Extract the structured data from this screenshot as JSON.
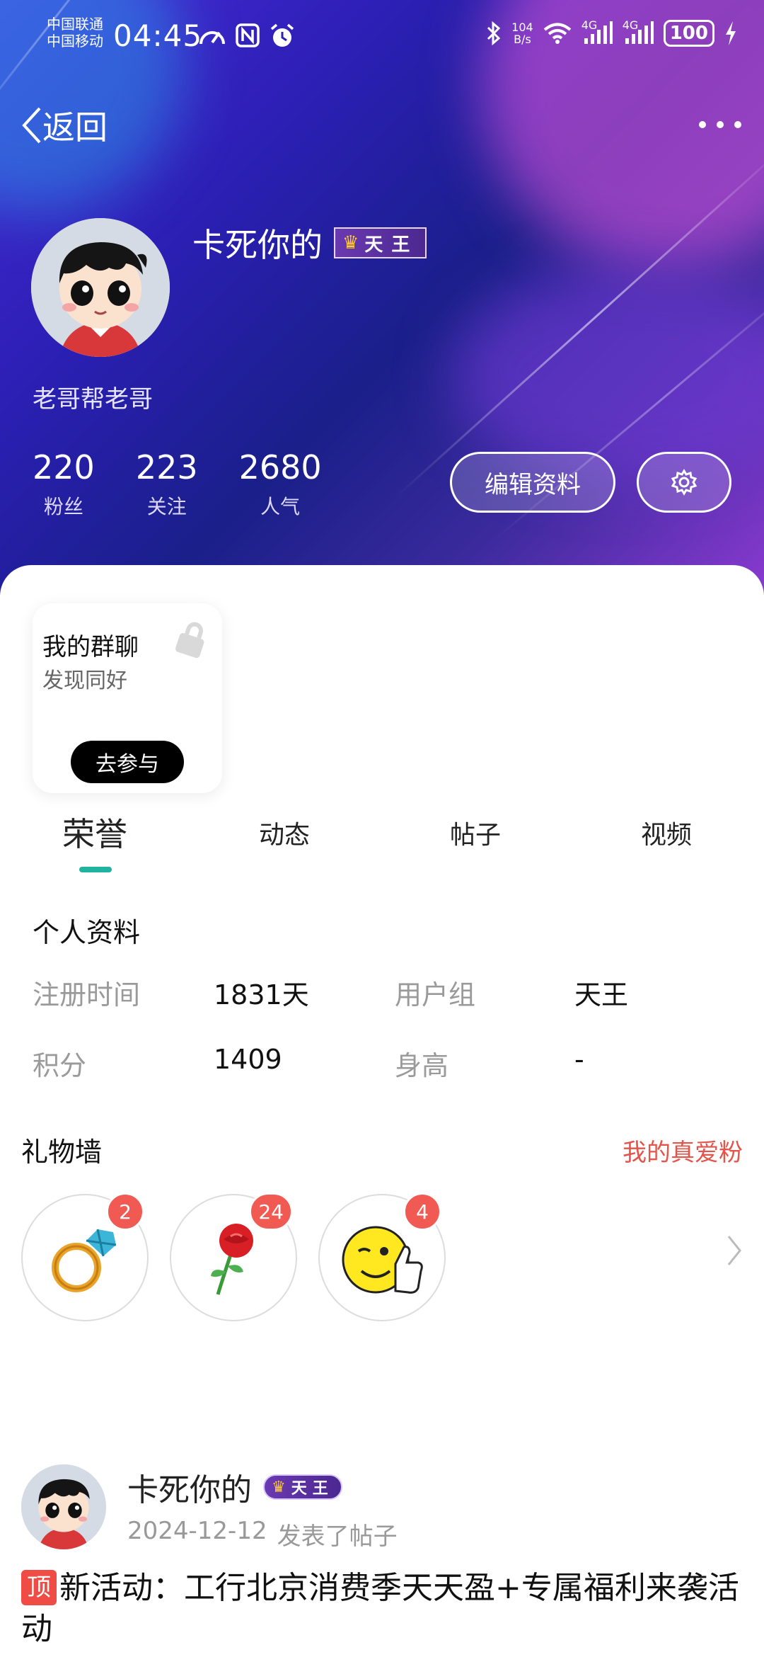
{
  "status_bar": {
    "carrier1": "中国联通",
    "carrier2": "中国移动",
    "time": "04:45",
    "net_speed_value": "104",
    "net_speed_unit": "B/s",
    "signal1_type": "4G",
    "signal2_type": "4G",
    "battery": "100",
    "icons_left": [
      "speedometer-icon",
      "nfc-icon",
      "alarm-icon"
    ],
    "icons_right": [
      "bluetooth-icon",
      "wifi-icon",
      "signal-icon",
      "charging-icon"
    ]
  },
  "nav": {
    "back_label": "返回",
    "more_icon": "more-dots-icon"
  },
  "profile": {
    "username": "卡死你的",
    "rank_badge": "天王",
    "signature": "老哥帮老哥",
    "stats": [
      {
        "value": "220",
        "label": "粉丝"
      },
      {
        "value": "223",
        "label": "关注"
      },
      {
        "value": "2680",
        "label": "人气"
      }
    ],
    "edit_button": "编辑资料",
    "settings_icon": "gear-icon"
  },
  "group_card": {
    "title": "我的群聊",
    "subtitle": "发现同好",
    "button": "去参与"
  },
  "tabs": [
    "荣誉",
    "动态",
    "帖子",
    "视频"
  ],
  "active_tab": "荣誉",
  "personal_info": {
    "title": "个人资料",
    "register_label": "注册时间",
    "register_value": "1831天",
    "group_label": "用户组",
    "group_value": "天王",
    "points_label": "积分",
    "points_value": "1409",
    "height_label": "身高",
    "height_value": "-"
  },
  "gift_wall": {
    "title": "礼物墙",
    "link": "我的真爱粉",
    "gifts": [
      {
        "name": "ring",
        "count": "2"
      },
      {
        "name": "rose",
        "count": "24"
      },
      {
        "name": "thumbs-up-smiley",
        "count": "4"
      }
    ]
  },
  "post": {
    "author": "卡死你的",
    "rank_badge": "天王",
    "date": "2024-12-12",
    "action": "发表了帖子",
    "pin_label": "顶",
    "title": "新活动：工行北京消费季天天盈+专属福利来袭活动"
  },
  "colors": {
    "accent": "#1fb3a0",
    "link_red": "#e4544a",
    "badge_red": "#f05a52",
    "pin_red": "#ee4c45"
  }
}
